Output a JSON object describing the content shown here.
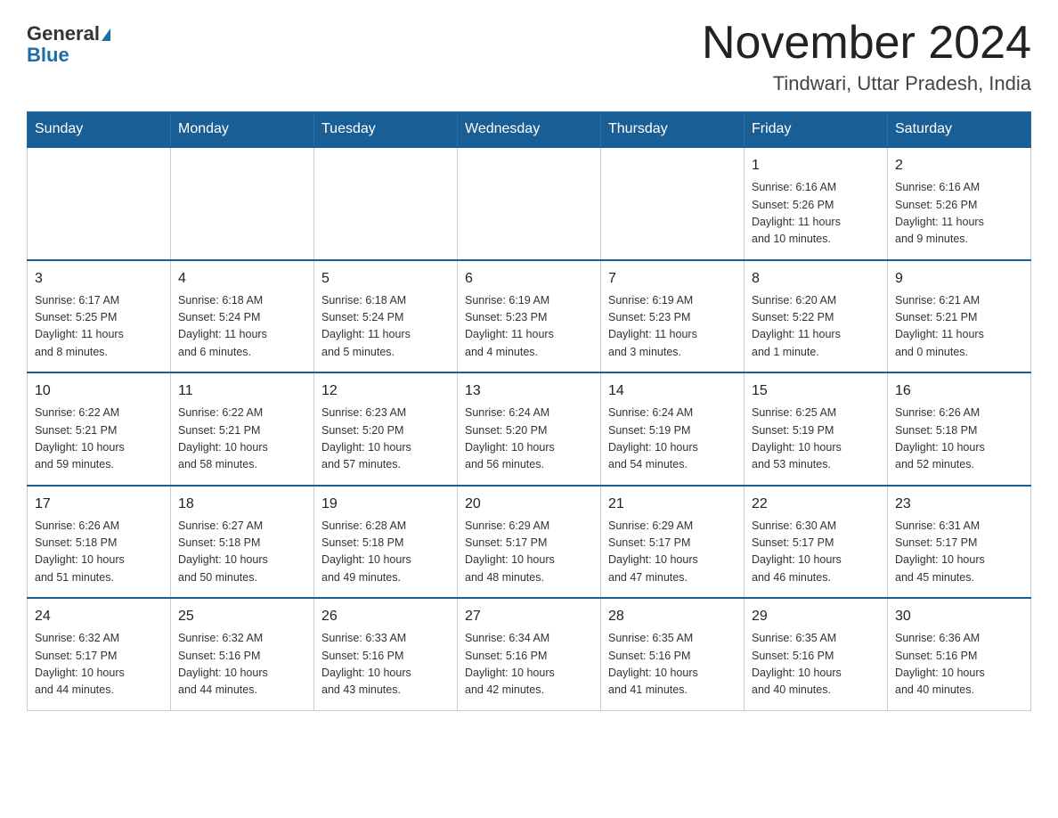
{
  "header": {
    "logo_line1": "General",
    "logo_line2": "Blue",
    "month_title": "November 2024",
    "location": "Tindwari, Uttar Pradesh, India"
  },
  "weekdays": [
    "Sunday",
    "Monday",
    "Tuesday",
    "Wednesday",
    "Thursday",
    "Friday",
    "Saturday"
  ],
  "weeks": [
    {
      "days": [
        {
          "number": "",
          "info": ""
        },
        {
          "number": "",
          "info": ""
        },
        {
          "number": "",
          "info": ""
        },
        {
          "number": "",
          "info": ""
        },
        {
          "number": "",
          "info": ""
        },
        {
          "number": "1",
          "info": "Sunrise: 6:16 AM\nSunset: 5:26 PM\nDaylight: 11 hours\nand 10 minutes."
        },
        {
          "number": "2",
          "info": "Sunrise: 6:16 AM\nSunset: 5:26 PM\nDaylight: 11 hours\nand 9 minutes."
        }
      ]
    },
    {
      "days": [
        {
          "number": "3",
          "info": "Sunrise: 6:17 AM\nSunset: 5:25 PM\nDaylight: 11 hours\nand 8 minutes."
        },
        {
          "number": "4",
          "info": "Sunrise: 6:18 AM\nSunset: 5:24 PM\nDaylight: 11 hours\nand 6 minutes."
        },
        {
          "number": "5",
          "info": "Sunrise: 6:18 AM\nSunset: 5:24 PM\nDaylight: 11 hours\nand 5 minutes."
        },
        {
          "number": "6",
          "info": "Sunrise: 6:19 AM\nSunset: 5:23 PM\nDaylight: 11 hours\nand 4 minutes."
        },
        {
          "number": "7",
          "info": "Sunrise: 6:19 AM\nSunset: 5:23 PM\nDaylight: 11 hours\nand 3 minutes."
        },
        {
          "number": "8",
          "info": "Sunrise: 6:20 AM\nSunset: 5:22 PM\nDaylight: 11 hours\nand 1 minute."
        },
        {
          "number": "9",
          "info": "Sunrise: 6:21 AM\nSunset: 5:21 PM\nDaylight: 11 hours\nand 0 minutes."
        }
      ]
    },
    {
      "days": [
        {
          "number": "10",
          "info": "Sunrise: 6:22 AM\nSunset: 5:21 PM\nDaylight: 10 hours\nand 59 minutes."
        },
        {
          "number": "11",
          "info": "Sunrise: 6:22 AM\nSunset: 5:21 PM\nDaylight: 10 hours\nand 58 minutes."
        },
        {
          "number": "12",
          "info": "Sunrise: 6:23 AM\nSunset: 5:20 PM\nDaylight: 10 hours\nand 57 minutes."
        },
        {
          "number": "13",
          "info": "Sunrise: 6:24 AM\nSunset: 5:20 PM\nDaylight: 10 hours\nand 56 minutes."
        },
        {
          "number": "14",
          "info": "Sunrise: 6:24 AM\nSunset: 5:19 PM\nDaylight: 10 hours\nand 54 minutes."
        },
        {
          "number": "15",
          "info": "Sunrise: 6:25 AM\nSunset: 5:19 PM\nDaylight: 10 hours\nand 53 minutes."
        },
        {
          "number": "16",
          "info": "Sunrise: 6:26 AM\nSunset: 5:18 PM\nDaylight: 10 hours\nand 52 minutes."
        }
      ]
    },
    {
      "days": [
        {
          "number": "17",
          "info": "Sunrise: 6:26 AM\nSunset: 5:18 PM\nDaylight: 10 hours\nand 51 minutes."
        },
        {
          "number": "18",
          "info": "Sunrise: 6:27 AM\nSunset: 5:18 PM\nDaylight: 10 hours\nand 50 minutes."
        },
        {
          "number": "19",
          "info": "Sunrise: 6:28 AM\nSunset: 5:18 PM\nDaylight: 10 hours\nand 49 minutes."
        },
        {
          "number": "20",
          "info": "Sunrise: 6:29 AM\nSunset: 5:17 PM\nDaylight: 10 hours\nand 48 minutes."
        },
        {
          "number": "21",
          "info": "Sunrise: 6:29 AM\nSunset: 5:17 PM\nDaylight: 10 hours\nand 47 minutes."
        },
        {
          "number": "22",
          "info": "Sunrise: 6:30 AM\nSunset: 5:17 PM\nDaylight: 10 hours\nand 46 minutes."
        },
        {
          "number": "23",
          "info": "Sunrise: 6:31 AM\nSunset: 5:17 PM\nDaylight: 10 hours\nand 45 minutes."
        }
      ]
    },
    {
      "days": [
        {
          "number": "24",
          "info": "Sunrise: 6:32 AM\nSunset: 5:17 PM\nDaylight: 10 hours\nand 44 minutes."
        },
        {
          "number": "25",
          "info": "Sunrise: 6:32 AM\nSunset: 5:16 PM\nDaylight: 10 hours\nand 44 minutes."
        },
        {
          "number": "26",
          "info": "Sunrise: 6:33 AM\nSunset: 5:16 PM\nDaylight: 10 hours\nand 43 minutes."
        },
        {
          "number": "27",
          "info": "Sunrise: 6:34 AM\nSunset: 5:16 PM\nDaylight: 10 hours\nand 42 minutes."
        },
        {
          "number": "28",
          "info": "Sunrise: 6:35 AM\nSunset: 5:16 PM\nDaylight: 10 hours\nand 41 minutes."
        },
        {
          "number": "29",
          "info": "Sunrise: 6:35 AM\nSunset: 5:16 PM\nDaylight: 10 hours\nand 40 minutes."
        },
        {
          "number": "30",
          "info": "Sunrise: 6:36 AM\nSunset: 5:16 PM\nDaylight: 10 hours\nand 40 minutes."
        }
      ]
    }
  ]
}
